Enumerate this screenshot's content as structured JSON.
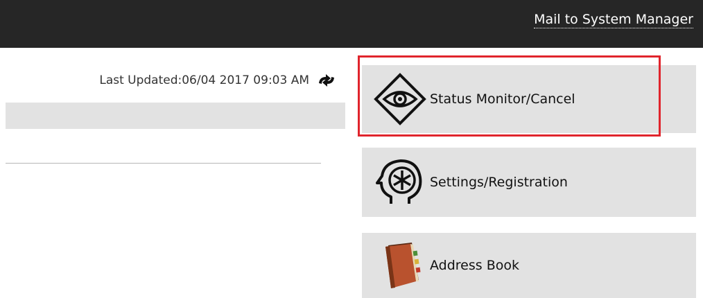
{
  "header": {
    "mail_link": "Mail to System Manager"
  },
  "status": {
    "last_updated_label": "Last Updated:06/04 2017 09:03 AM",
    "refresh_icon": "refresh-icon"
  },
  "menu": {
    "items": [
      {
        "label": "Status Monitor/Cancel",
        "icon": "eye-diamond-icon",
        "highlighted": true
      },
      {
        "label": "Settings/Registration",
        "icon": "settings-head-icon"
      },
      {
        "label": "Address Book",
        "icon": "address-book-icon"
      }
    ]
  },
  "colors": {
    "topbar": "#262626",
    "tile_bg": "#e2e2e2",
    "highlight": "#e0242c"
  }
}
